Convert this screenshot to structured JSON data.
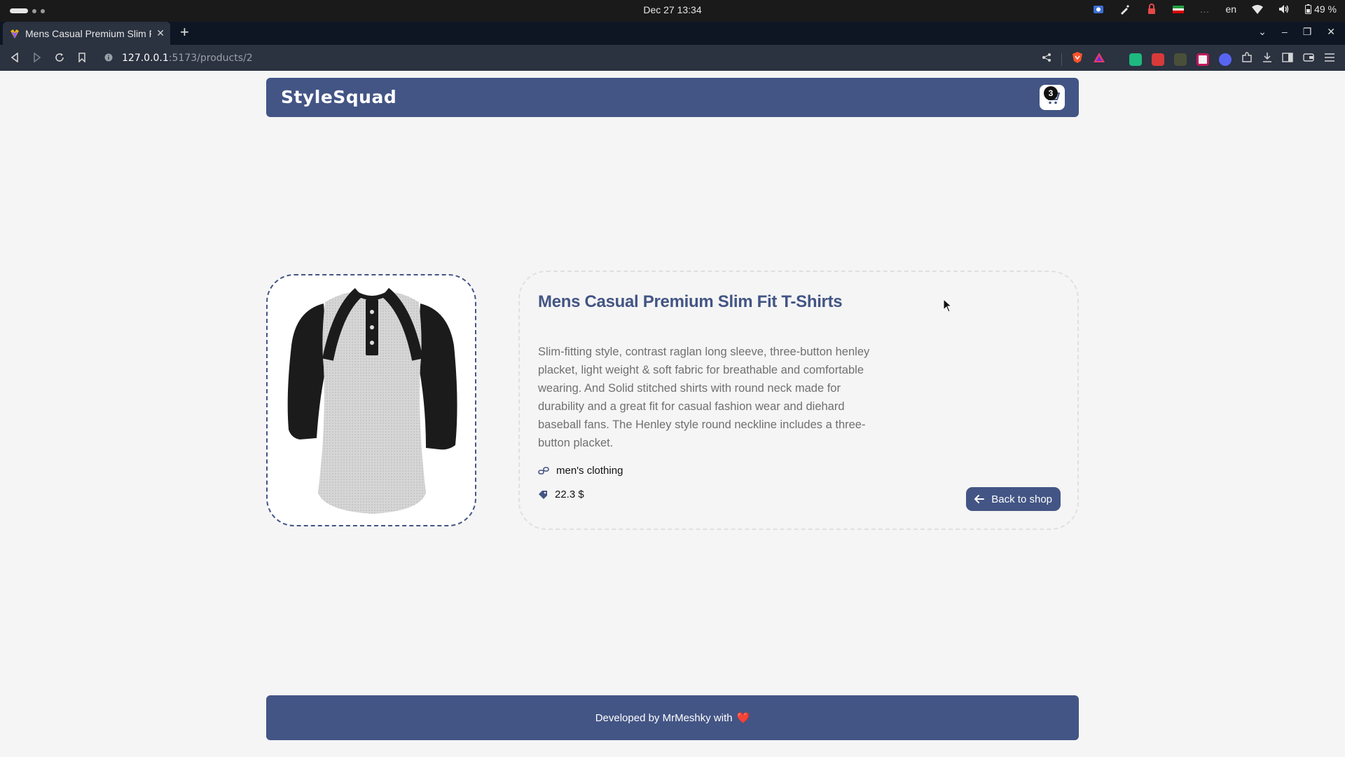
{
  "os": {
    "clock": "Dec 27  13:34",
    "language": "en",
    "battery": "49 %"
  },
  "browser": {
    "tab_title": "Mens Casual Premium Slim Fit T-Shirts",
    "new_tab_label": "+",
    "url_host": "127.0.0.1",
    "url_path": ":5173/products/2"
  },
  "header": {
    "logo": "StyleSquad",
    "cart_count": "3"
  },
  "product": {
    "title": "Mens Casual Premium Slim Fit T-Shirts",
    "description": "Slim-fitting style, contrast raglan long sleeve, three-button henley placket, light weight & soft fabric for breathable and comfortable wearing. And Solid stitched shirts with round neck made for durability and a great fit for casual fashion wear and diehard baseball fans. The Henley style round neckline includes a three-button placket.",
    "category": "men's clothing",
    "price": "22.3 $",
    "back_label": "Back to shop"
  },
  "footer": {
    "text": "Developed by MrMeshky with",
    "heart": "❤️"
  },
  "colors": {
    "brand": "#435585",
    "page_bg": "#f5f5f5"
  }
}
